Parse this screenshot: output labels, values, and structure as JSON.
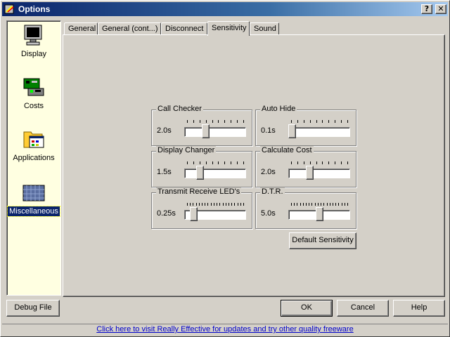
{
  "window": {
    "title": "Options",
    "help_btn": "?",
    "close_btn": "✕"
  },
  "sidebar": {
    "items": [
      {
        "label": "Display",
        "icon": "monitor-icon",
        "selected": false
      },
      {
        "label": "Costs",
        "icon": "circuit-board-icon",
        "selected": false
      },
      {
        "label": "Applications",
        "icon": "folder-applications-icon",
        "selected": false
      },
      {
        "label": "Miscellaneous",
        "icon": "misc-icon",
        "selected": true
      }
    ]
  },
  "tabs": [
    {
      "label": "General",
      "active": false
    },
    {
      "label": "General (cont...)",
      "active": false
    },
    {
      "label": "Disconnect",
      "active": false
    },
    {
      "label": "Sensitivity",
      "active": true
    },
    {
      "label": "Sound",
      "active": false
    }
  ],
  "sensitivity": {
    "groups": [
      {
        "title": "Call Checker",
        "value": "2.0s",
        "ticks": 10,
        "level": 0.33
      },
      {
        "title": "Auto Hide",
        "value": "0.1s",
        "ticks": 10,
        "level": 0.0
      },
      {
        "title": "Display Changer",
        "value": "1.5s",
        "ticks": 10,
        "level": 0.22
      },
      {
        "title": "Calculate Cost",
        "value": "2.0s",
        "ticks": 10,
        "level": 0.33
      },
      {
        "title": "Transmit Receive LED's",
        "value": "0.25s",
        "ticks": 20,
        "level": 0.1
      },
      {
        "title": "D.T.R.",
        "value": "5.0s",
        "ticks": 20,
        "level": 0.5
      }
    ],
    "default_button": "Default Sensitivity"
  },
  "buttons": {
    "debug": "Debug File",
    "ok": "OK",
    "cancel": "Cancel",
    "help": "Help"
  },
  "footer_link": "Click here to visit Really Effective for updates and try other quality freeware",
  "colors": {
    "title_bar": "#0a246a",
    "sidebar_bg": "#ffffe1",
    "face": "#d4d0c8",
    "link": "#0000cc"
  }
}
